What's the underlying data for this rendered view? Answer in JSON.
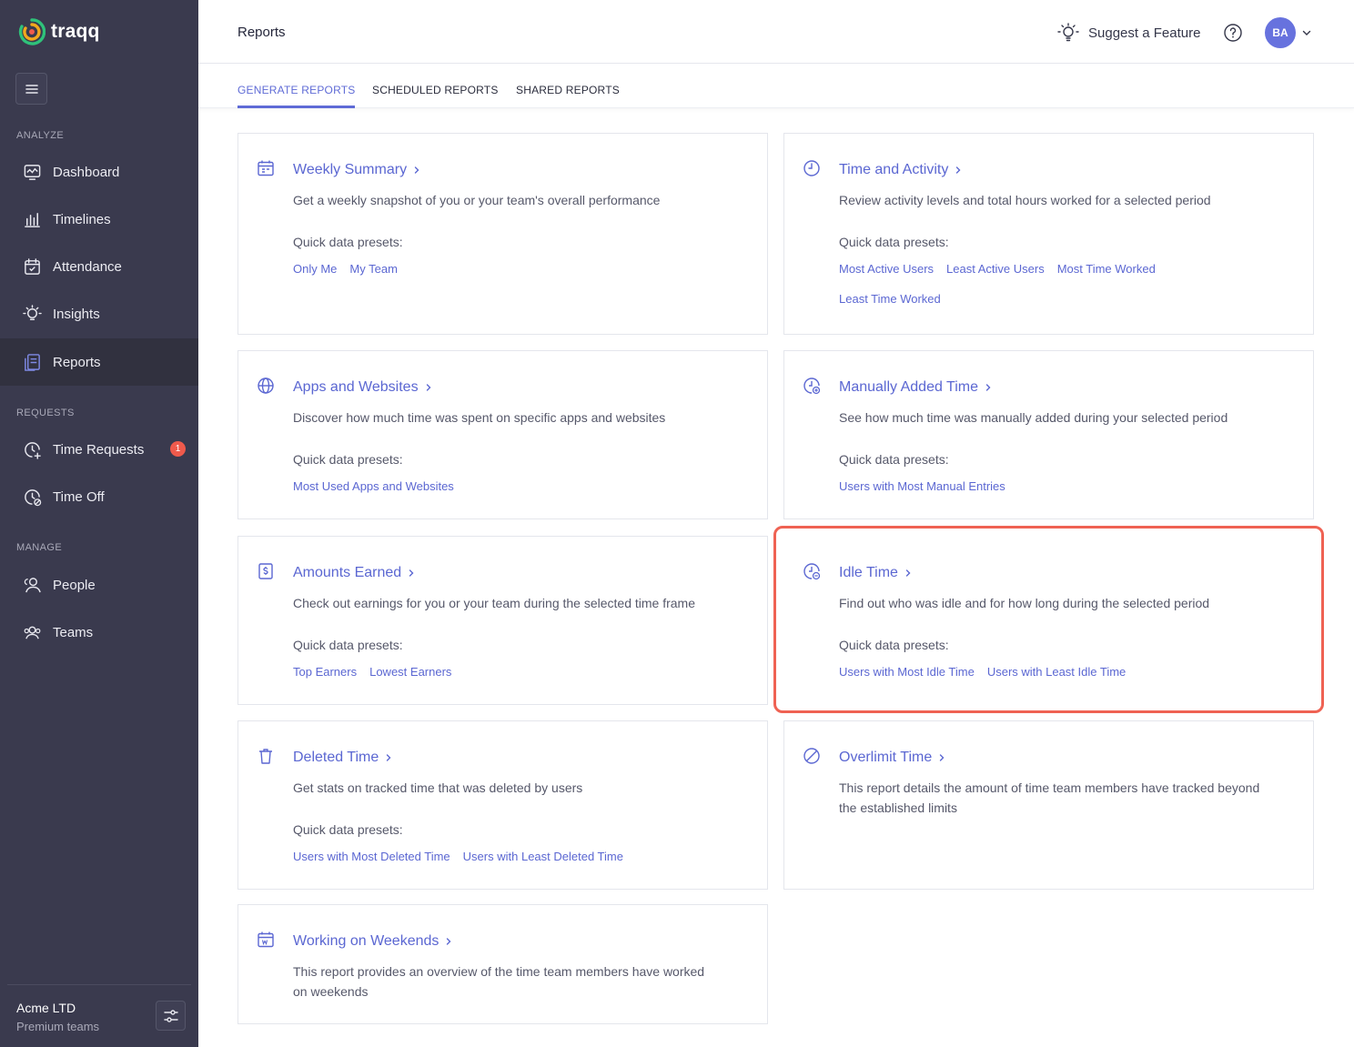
{
  "app": {
    "logo_text": "traqq"
  },
  "sidebar": {
    "sections": {
      "analyze": "ANALYZE",
      "requests": "REQUESTS",
      "manage": "MANAGE"
    },
    "items": [
      {
        "label": "Dashboard",
        "icon": "dashboard-icon"
      },
      {
        "label": "Timelines",
        "icon": "bar-chart-icon"
      },
      {
        "label": "Attendance",
        "icon": "calendar-check-icon"
      },
      {
        "label": "Insights",
        "icon": "lightbulb-icon"
      },
      {
        "label": "Reports",
        "icon": "report-icon",
        "active": true
      },
      {
        "label": "Time Requests",
        "icon": "clock-plus-icon",
        "badge": "1"
      },
      {
        "label": "Time Off",
        "icon": "clock-off-icon"
      },
      {
        "label": "People",
        "icon": "people-icon"
      },
      {
        "label": "Teams",
        "icon": "teams-icon"
      }
    ],
    "footer": {
      "company": "Acme LTD",
      "plan": "Premium teams"
    }
  },
  "header": {
    "title": "Reports",
    "suggest_label": "Suggest a Feature",
    "avatar_initials": "BA"
  },
  "tabs": [
    {
      "label": "GENERATE REPORTS",
      "active": true
    },
    {
      "label": "SCHEDULED REPORTS"
    },
    {
      "label": "SHARED REPORTS"
    }
  ],
  "presets_label": "Quick data presets:",
  "cards": {
    "weekly_summary": {
      "title": "Weekly Summary",
      "desc": "Get a weekly snapshot of you or your team's overall performance",
      "presets": [
        "Only Me",
        "My Team"
      ]
    },
    "time_activity": {
      "title": "Time and Activity",
      "desc": "Review activity levels and total hours worked for a selected period",
      "presets": [
        "Most Active Users",
        "Least Active Users",
        "Most Time Worked",
        "Least Time Worked"
      ]
    },
    "apps_websites": {
      "title": "Apps and Websites",
      "desc": "Discover how much time was spent on specific apps and websites",
      "presets": [
        "Most Used Apps and Websites"
      ]
    },
    "manual_time": {
      "title": "Manually Added Time",
      "desc": "See how much time was manually added during your selected period",
      "presets": [
        "Users with Most Manual Entries"
      ]
    },
    "amounts_earned": {
      "title": "Amounts Earned",
      "desc": "Check out earnings for you or your team during the selected time frame",
      "presets": [
        "Top Earners",
        "Lowest Earners"
      ]
    },
    "idle_time": {
      "title": "Idle Time",
      "desc": "Find out who was idle and for how long during the selected period",
      "presets": [
        "Users with Most Idle Time",
        "Users with Least Idle Time"
      ]
    },
    "deleted_time": {
      "title": "Deleted Time",
      "desc": "Get stats on tracked time that was deleted by users",
      "presets": [
        "Users with Most Deleted Time",
        "Users with Least Deleted Time"
      ]
    },
    "overlimit_time": {
      "title": "Overlimit Time",
      "desc": "This report details the amount of time team members have tracked beyond the established limits"
    },
    "weekends": {
      "title": "Working on Weekends",
      "desc": "This report provides an overview of the time team members have worked on weekends"
    }
  },
  "colors": {
    "sidebar_bg": "#3a3a4e",
    "accent": "#5b67d2",
    "highlight": "#ef6253",
    "badge": "#ef5a4c"
  }
}
